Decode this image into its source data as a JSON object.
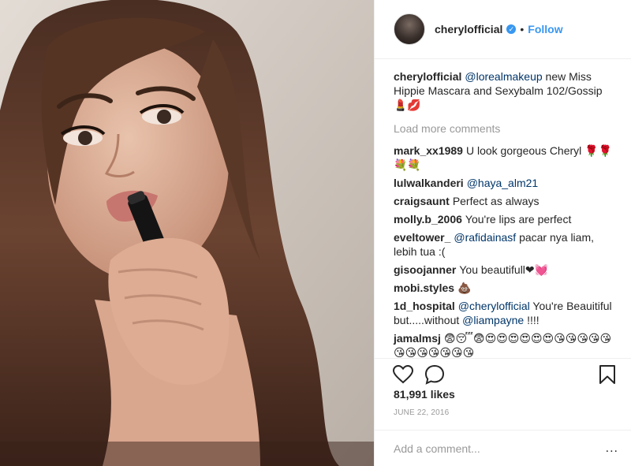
{
  "post": {
    "photo_icon": "woman-applying-lipstick-photo"
  },
  "header": {
    "username": "cherylofficial",
    "verified_icon": "verified-badge-icon",
    "separator": "•",
    "follow_label": "Follow"
  },
  "caption": {
    "username": "cherylofficial",
    "mention": "@lorealmakeup",
    "text": " new Miss Hippie Mascara and Sexybalm 102/Gossip 💄💋"
  },
  "load_more_label": "Load more comments",
  "comments": [
    {
      "user": "mark_xx1989",
      "pre": "",
      "mention": "",
      "text": "U look gorgeous Cheryl 🌹🌹💐💐"
    },
    {
      "user": "lulwalkanderi",
      "pre": "",
      "mention": "@haya_alm21",
      "text": ""
    },
    {
      "user": "craigsaunt",
      "pre": "",
      "mention": "",
      "text": "Perfect as always"
    },
    {
      "user": "molly.b_2006",
      "pre": "",
      "mention": "",
      "text": "You're lips are perfect"
    },
    {
      "user": "eveltower_",
      "pre": "",
      "mention": "@rafidainasf",
      "text": " pacar nya liam, lebih tua :("
    },
    {
      "user": "gisoojanner",
      "pre": "",
      "mention": "",
      "text": "You beautifull❤💓"
    },
    {
      "user": "mobi.styles",
      "pre": "",
      "mention": "",
      "text": "💩"
    },
    {
      "user": "1d_hospital",
      "pre": "",
      "mention": "@cherylofficial",
      "text": " You're Beauitiful but.....without ",
      "mention2": "@liampayne",
      "text2": " !!!!"
    },
    {
      "user": "jamalmsj",
      "pre": "",
      "mention": "",
      "text": "😨😴😨😍😍😍😍😍😍😘😘😘😘😘😘😘😘😘😘😘😘"
    }
  ],
  "actions": {
    "like_icon": "heart-icon",
    "comment_icon": "comment-bubble-icon",
    "save_icon": "bookmark-icon"
  },
  "likes": "81,991 likes",
  "date": "JUNE 22, 2016",
  "add_comment": {
    "placeholder": "Add a comment...",
    "more_label": "..."
  }
}
